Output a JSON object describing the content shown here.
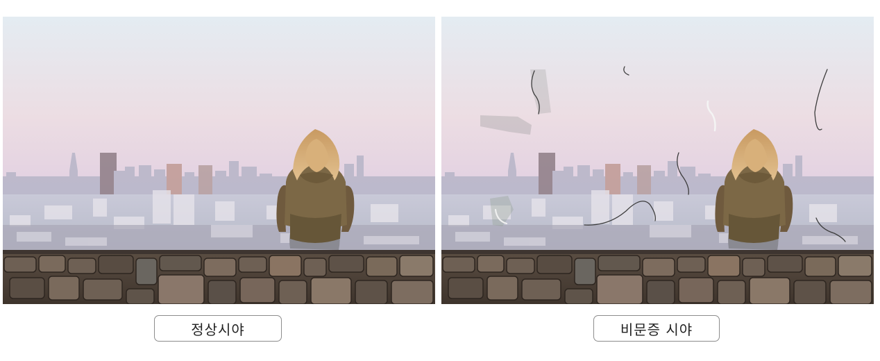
{
  "captions": {
    "normal": "정상시야",
    "floaters": "비문증 시야"
  }
}
